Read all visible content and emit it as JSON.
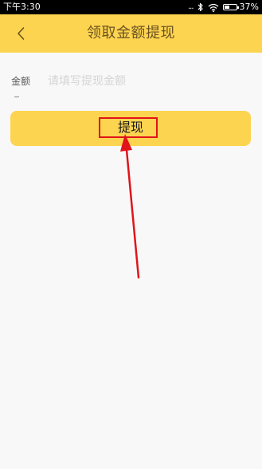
{
  "status_bar": {
    "time": "下午3:30",
    "signal_dots": "...",
    "battery_percent": "37%"
  },
  "header": {
    "title": "领取金额提现"
  },
  "form": {
    "amount_label": "金额",
    "amount_placeholder": "请填写提现金额"
  },
  "actions": {
    "withdraw_label": "提现"
  },
  "theme": {
    "primary": "#fdd450",
    "highlight": "#e0141a",
    "background": "#f8f8f8"
  },
  "icons": {
    "back": "chevron-left-icon",
    "bluetooth": "bluetooth-icon",
    "wifi": "wifi-icon",
    "battery": "battery-icon"
  }
}
